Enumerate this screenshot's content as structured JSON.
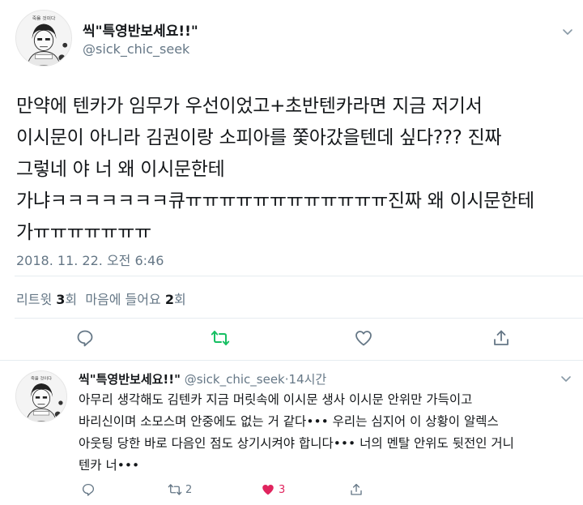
{
  "main_tweet": {
    "display_name": "씩\"특영반보세요!!\"",
    "handle": "@sick_chic_seek",
    "text": "만약에 텐카가 임무가 우선이었고+초반텐카라면 지금 저기서\n이시문이 아니라 김권이랑 소피아를 쫓아갔을텐데 싶다??? 진짜\n그렇네 야 너 왜 이시문한테\n가냐ㅋㅋㅋㅋㅋㅋㅋ큐ㅠㅠㅠㅠㅠㅠㅠㅠㅠㅠㅠㅠ진짜 왜 이시문한테\n가ㅠㅠㅠㅠㅠㅠㅠ",
    "timestamp": "2018. 11. 22. 오전 6:46",
    "retweets_label": "리트윗",
    "retweets_count": "3",
    "retweets_unit": "회",
    "likes_label": "마음에 들어요",
    "likes_count": "2",
    "likes_unit": "회",
    "avatar_text": "죽을 것이다"
  },
  "reply_tweet": {
    "display_name": "씩\"특영반보세요!!\"",
    "handle": "@sick_chic_seek",
    "separator": "·",
    "time": "14시간",
    "text": "아무리 생각해도 김텐카 지금 머릿속에 이시문 생사 이시문 안위만 가득이고\n바리신이며 소모스며 안중에도 없는 거 같다••• 우리는 심지어 이 상황이 알렉스\n아웃팅 당한 바로 다음인 점도 상기시켜야 합니다••• 너의 멘탈 안위도 뒷전인 거니\n텐카 너•••",
    "retweet_count": "2",
    "like_count": "3",
    "avatar_text": "죽을 것이다"
  },
  "icons": {
    "reply": "reply-bubble-icon",
    "retweet": "retweet-arrows-icon",
    "like": "heart-icon",
    "share": "share-upload-icon",
    "menu": "chevron-down-icon"
  },
  "colors": {
    "text": "#14171a",
    "secondary": "#657786",
    "retweet_green": "#17bf63",
    "like_pink": "#e0245e",
    "divider": "#e6ecf0"
  }
}
